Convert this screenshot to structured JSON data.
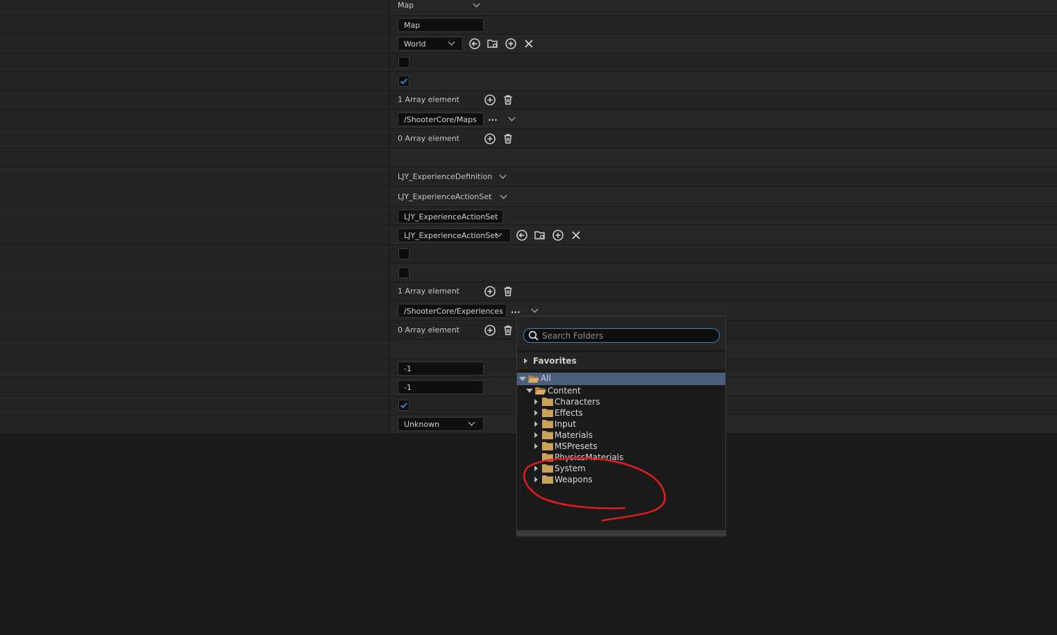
{
  "rows": {
    "map_combo_label": "Map",
    "map_field": "Map",
    "world_combo": "World",
    "array1_count": "1 Array element",
    "maps_path": "/ShooterCore/Maps",
    "array2_count": "0 Array element",
    "experience_def": "LJY_ExperienceDefinition",
    "experience_action_set": "LJY_ExperienceActionSet",
    "action_set_field": "LJY_ExperienceActionSet",
    "action_set_combo": "LJY_ExperienceActionSet",
    "array3_count": "1 Array element",
    "experiences_path": "/ShooterCore/Experiences",
    "array4_count": "0 Array element",
    "value_a": "-1",
    "value_b": "-1",
    "unknown_combo": "Unknown",
    "ellipsis": "..."
  },
  "popup": {
    "search_placeholder": "Search Folders",
    "favorites_label": "Favorites",
    "tree": {
      "all": "All",
      "content": "Content",
      "children": [
        "Characters",
        "Effects",
        "Input",
        "Materials",
        "MSPresets",
        "PhysicsMaterials",
        "System",
        "Weapons"
      ]
    }
  },
  "colors": {
    "panel_bg": "#242424",
    "selection": "#4a5f7e",
    "accent_blue": "#3a87c9",
    "folder": "#c9a25a",
    "annotation_red": "#e01b1b"
  }
}
